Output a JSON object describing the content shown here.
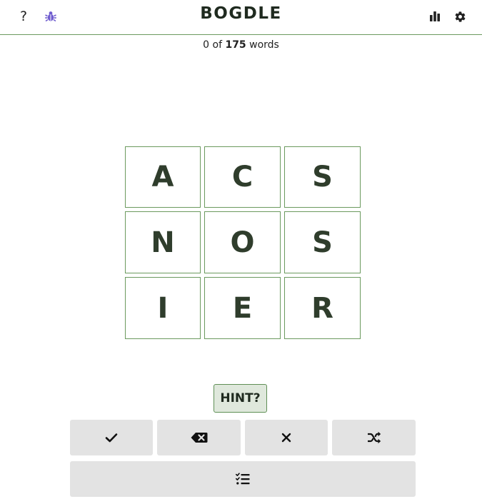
{
  "header": {
    "title": "BOGDLE",
    "help_label": "?"
  },
  "icons": {
    "help": "question-mark-icon",
    "bug": "bug-icon",
    "stats": "bar-chart-icon",
    "settings": "gear-icon",
    "enter": "checkmark-icon",
    "backspace": "backspace-icon",
    "clear": "close-icon",
    "shuffle": "shuffle-icon",
    "word_list": "checklist-icon"
  },
  "progress": {
    "found": "0",
    "of": "of",
    "total": "175",
    "words": "words"
  },
  "board": {
    "tiles": [
      "A",
      "C",
      "S",
      "N",
      "O",
      "S",
      "I",
      "E",
      "R"
    ]
  },
  "hint_label": "HINT?",
  "colors": {
    "accent_green": "#6b9a5e",
    "tile_text": "#2f3d2c",
    "bug_purple": "#6f5ccf",
    "button_gray": "#e3e3e3",
    "hint_bg": "#dfe8dc"
  }
}
